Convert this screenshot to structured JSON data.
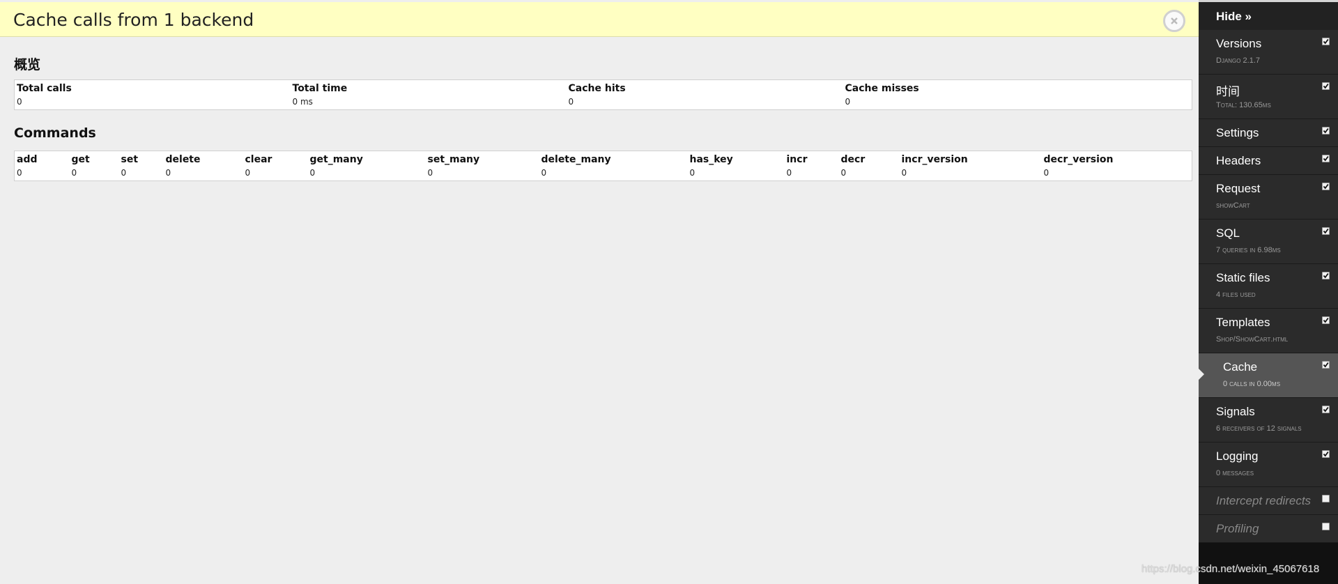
{
  "panel": {
    "title": "Cache calls from 1 backend",
    "close_icon": "close-icon"
  },
  "overview": {
    "title": "概览",
    "headers": [
      "Total calls",
      "Total time",
      "Cache hits",
      "Cache misses"
    ],
    "values": [
      "0",
      "0 ms",
      "0",
      "0"
    ]
  },
  "commands": {
    "title": "Commands",
    "headers": [
      "add",
      "get",
      "set",
      "delete",
      "clear",
      "get_many",
      "set_many",
      "delete_many",
      "has_key",
      "incr",
      "decr",
      "incr_version",
      "decr_version"
    ],
    "values": [
      "0",
      "0",
      "0",
      "0",
      "0",
      "0",
      "0",
      "0",
      "0",
      "0",
      "0",
      "0",
      "0"
    ]
  },
  "toolbar": {
    "hide_label": "Hide »",
    "items": [
      {
        "label": "Versions",
        "sub": "Django 2.1.7",
        "checked": true
      },
      {
        "label": "时间",
        "sub": "Total: 130.65ms",
        "checked": true
      },
      {
        "label": "Settings",
        "sub": "",
        "checked": true
      },
      {
        "label": "Headers",
        "sub": "",
        "checked": true
      },
      {
        "label": "Request",
        "sub": "showCart",
        "checked": true
      },
      {
        "label": "SQL",
        "sub": "7 queries in 6.98ms",
        "checked": true
      },
      {
        "label": "Static files",
        "sub": "4 files used",
        "checked": true
      },
      {
        "label": "Templates",
        "sub": "Shop/ShowCart.html",
        "checked": true
      },
      {
        "label": "Cache",
        "sub": "0 calls in 0.00ms",
        "checked": true
      },
      {
        "label": "Signals",
        "sub": "6 receivers of 12 signals",
        "checked": true
      },
      {
        "label": "Logging",
        "sub": "0 messages",
        "checked": true
      },
      {
        "label": "Intercept redirects",
        "sub": "",
        "checked": false
      },
      {
        "label": "Profiling",
        "sub": "",
        "checked": false
      }
    ]
  },
  "watermark": "https://blog.csdn.net/weixin_45067618",
  "colors": {
    "header_bg": "#ffffc2",
    "toolbar_bg": "#2b2b2b",
    "active_bg": "#555555"
  }
}
